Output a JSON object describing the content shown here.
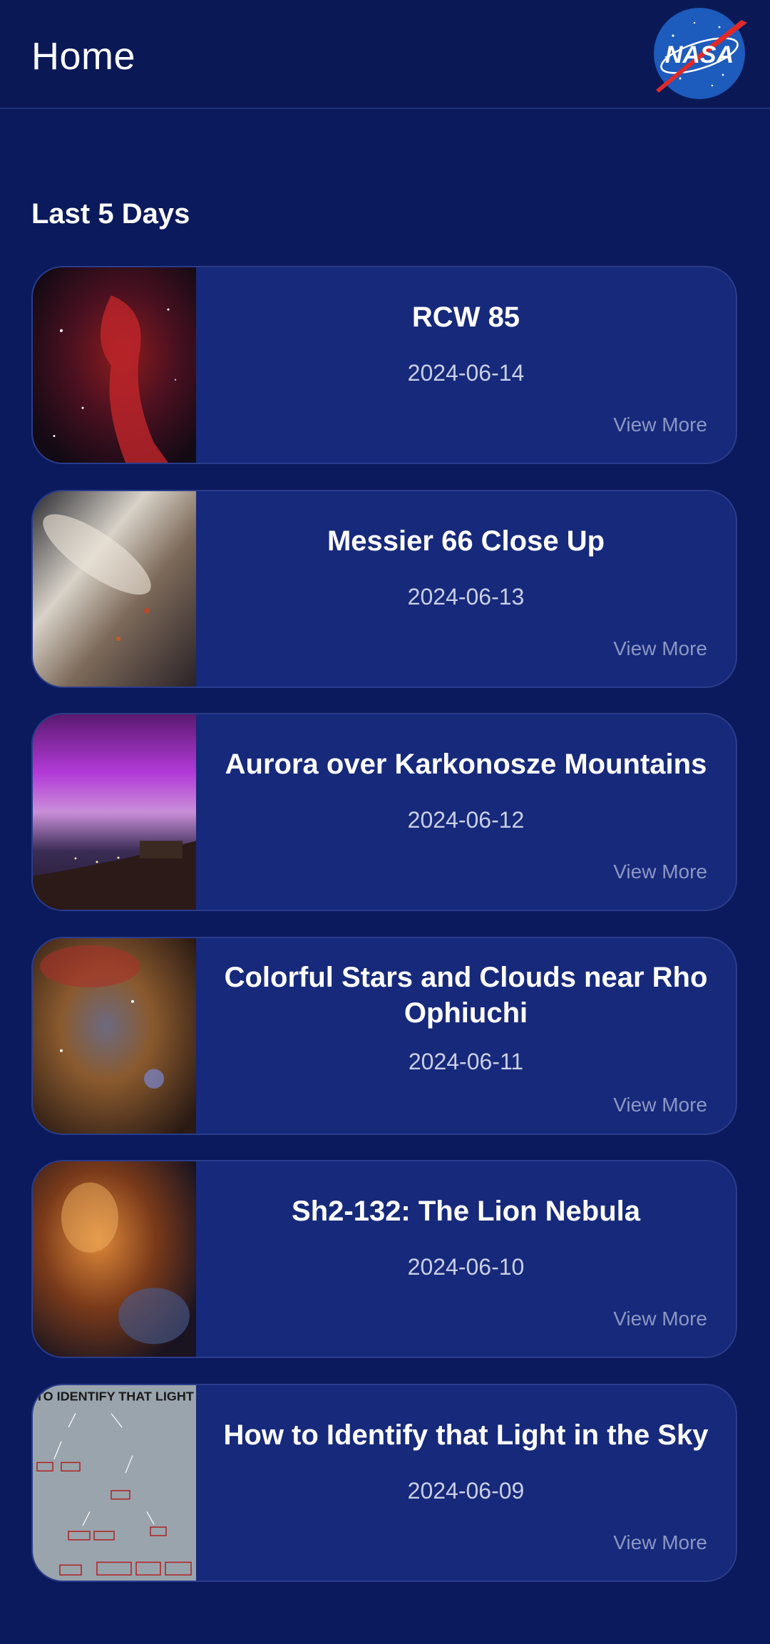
{
  "header": {
    "title": "Home",
    "logo_text": "NASA"
  },
  "section": {
    "title": "Last 5 Days"
  },
  "cards": [
    {
      "title": "RCW 85",
      "date": "2024-06-14",
      "view_more": "View More"
    },
    {
      "title": "Messier 66 Close Up",
      "date": "2024-06-13",
      "view_more": "View More"
    },
    {
      "title": "Aurora over Karkonosze Mountains",
      "date": "2024-06-12",
      "view_more": "View More"
    },
    {
      "title": "Colorful Stars and Clouds near Rho Ophiuchi",
      "date": "2024-06-11",
      "view_more": "View More"
    },
    {
      "title": "Sh2-132: The Lion Nebula",
      "date": "2024-06-10",
      "view_more": "View More"
    },
    {
      "title": "How to Identify that Light in the Sky",
      "date": "2024-06-09",
      "view_more": "View More",
      "thumb_text": "TO IDENTIFY THAT LIGHT IN THE"
    }
  ],
  "colors": {
    "background": "#0b1a5c",
    "card": "#17297a",
    "accent": "#8c97c6"
  }
}
